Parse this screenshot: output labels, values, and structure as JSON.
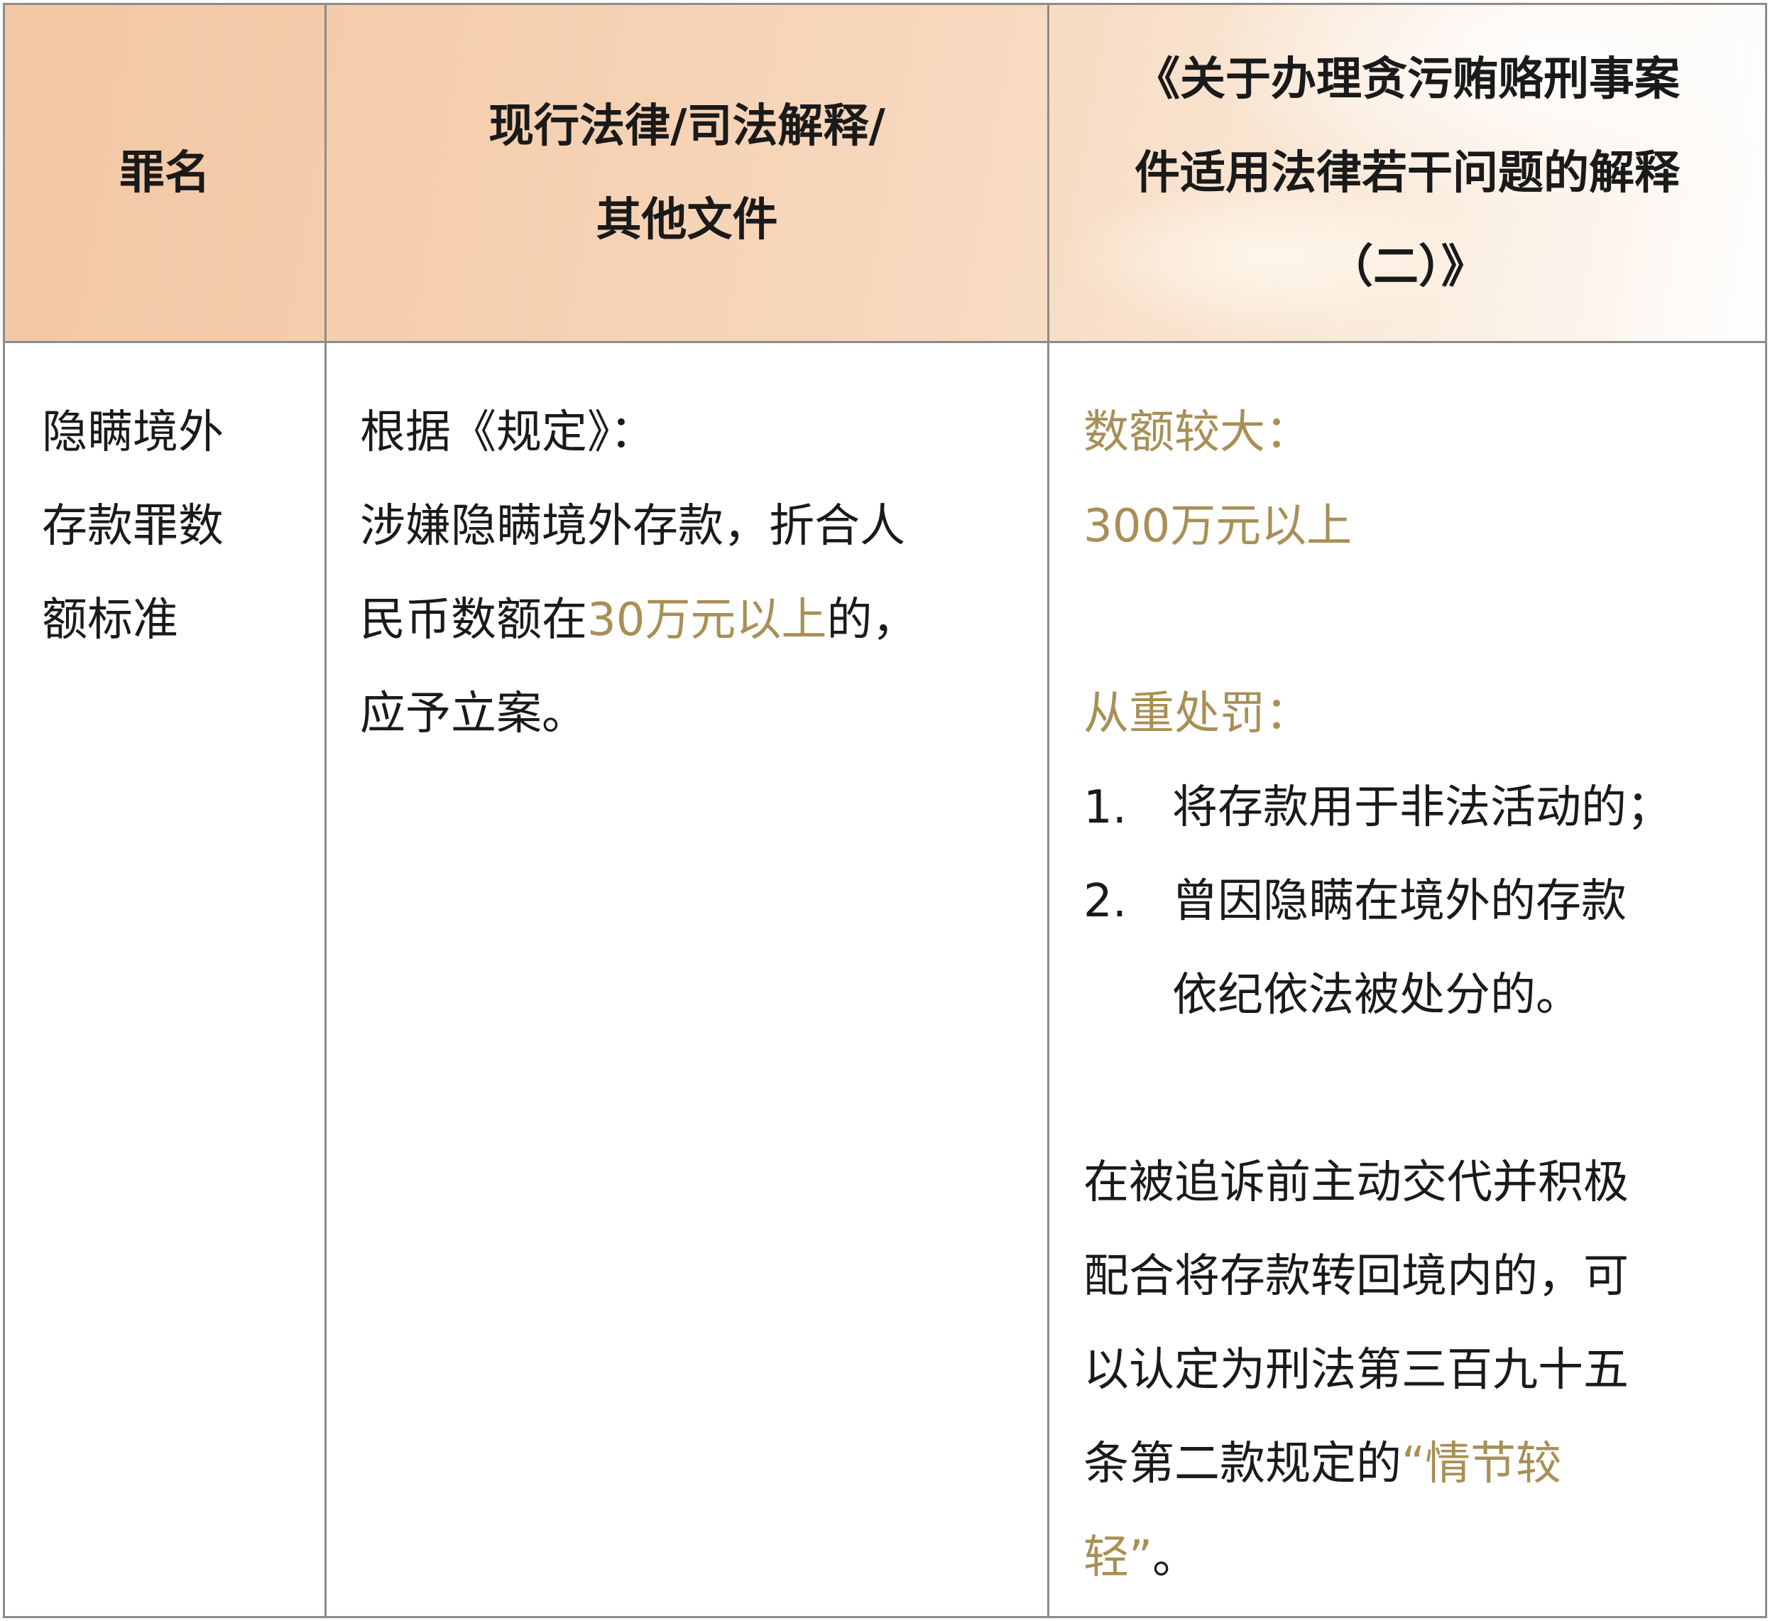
{
  "header": {
    "col1": "罪名",
    "col2_line1": "现行法律/司法解释/",
    "col2_line2": "其他文件",
    "col3_line1": "《关于办理贪污贿赂刑事案",
    "col3_line2": "件适用法律若干问题的解释",
    "col3_line3": "（二）》"
  },
  "row": {
    "crime_lines": [
      "隐瞒境外",
      "存款罪数",
      "额标准"
    ],
    "law": {
      "line1": "根据《规定》：",
      "line2": "涉嫌隐瞒境外存款，折合人",
      "line3_prefix": "民币数额在",
      "line3_highlight": "30万元以上",
      "line3_suffix": "的，",
      "line4": "应予立案。"
    },
    "interpretation": {
      "large_label": "数额较大：",
      "large_value": "300万元以上",
      "heavy_label": "从重处罚：",
      "items": [
        {
          "num": "1.",
          "lines": [
            "将存款用于非法活动的；"
          ]
        },
        {
          "num": "2.",
          "lines": [
            "曾因隐瞒在境外的存款",
            "依纪依法被处分的。"
          ]
        }
      ],
      "lenient_lines": [
        "在被追诉前主动交代并积极",
        "配合将存款转回境内的，可",
        "以认定为刑法第三百九十五"
      ],
      "lenient_line4_prefix": "条第二款规定的",
      "lenient_line4_highlight": "“情节较",
      "lenient_line5_highlight": "轻”",
      "lenient_line5_suffix": "。"
    }
  }
}
